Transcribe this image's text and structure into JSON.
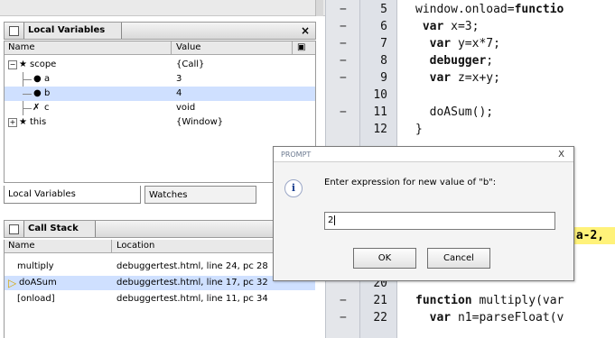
{
  "local_variables": {
    "title": "Local Variables",
    "close": "×",
    "columns": {
      "name": "Name",
      "value": "Value"
    },
    "rows": [
      {
        "name": "scope",
        "value": "{Call}"
      },
      {
        "name": "a",
        "value": "3"
      },
      {
        "name": "b",
        "value": "4"
      },
      {
        "name": "c",
        "value": "void"
      },
      {
        "name": "this",
        "value": "{Window}"
      }
    ],
    "tabs": [
      "Local Variables",
      "Watches"
    ]
  },
  "call_stack": {
    "title": "Call Stack",
    "columns": {
      "name": "Name",
      "location": "Location"
    },
    "rows": [
      {
        "name": "multiply",
        "location": "debuggertest.html, line 24, pc 28"
      },
      {
        "name": "doASum",
        "location": "debuggertest.html, line 17, pc 32"
      },
      {
        "name": "[onload]",
        "location": "debuggertest.html, line 11, pc 34"
      }
    ]
  },
  "code": {
    "lines": [
      {
        "num": "5",
        "minus": "−",
        "pre": "window.onload=",
        "kw": "functio",
        "post": ""
      },
      {
        "num": "6",
        "minus": "−",
        "pre": " ",
        "kw": "var",
        "post": " x=3;"
      },
      {
        "num": "7",
        "minus": "−",
        "pre": "  ",
        "kw": "var",
        "post": " y=x*7;"
      },
      {
        "num": "8",
        "minus": "−",
        "pre": "  ",
        "kw": "debugger",
        "post": ";"
      },
      {
        "num": "9",
        "minus": "−",
        "pre": "  ",
        "kw": "var",
        "post": " z=x+y;"
      },
      {
        "num": "10",
        "minus": "",
        "pre": "",
        "kw": "",
        "post": ""
      },
      {
        "num": "11",
        "minus": "−",
        "pre": "  doASum();",
        "kw": "",
        "post": ""
      },
      {
        "num": "12",
        "minus": "",
        "pre": "}",
        "kw": "",
        "post": ""
      },
      {
        "num": "",
        "minus": "",
        "pre": "",
        "kw": "",
        "post": ""
      },
      {
        "num": "",
        "minus": "",
        "pre": "            ) {",
        "kw": "",
        "post": ""
      },
      {
        "num": "",
        "minus": "",
        "pre": "",
        "kw": "",
        "post": ""
      },
      {
        "num": "",
        "minus": "",
        "pre": "",
        "kw": "",
        "post": ""
      },
      {
        "num": "",
        "minus": "",
        "pre": "",
        "kw": "",
        "post": ""
      },
      {
        "num": "",
        "minus": "",
        "pre": "",
        "kw": "",
        "post": ""
      },
      {
        "num": "",
        "minus": "",
        "pre": "",
        "kw": "",
        "post": ""
      },
      {
        "num": "",
        "minus": "",
        "pre": "",
        "kw": "",
        "post": ""
      },
      {
        "num": "20",
        "minus": "",
        "pre": "",
        "kw": "",
        "post": ""
      },
      {
        "num": "21",
        "minus": "−",
        "pre": "",
        "kw": "function",
        "post": " multiply(var"
      },
      {
        "num": "22",
        "minus": "−",
        "pre": "  ",
        "kw": "var",
        "post": " n1=parseFloat(v"
      }
    ],
    "highlight_text": "(a-2,",
    "semicolon": ";"
  },
  "prompt": {
    "title": "PROMPT",
    "close": "X",
    "message": "Enter expression for new value of \"b\":",
    "input_value": "2",
    "ok": "OK",
    "cancel": "Cancel"
  }
}
